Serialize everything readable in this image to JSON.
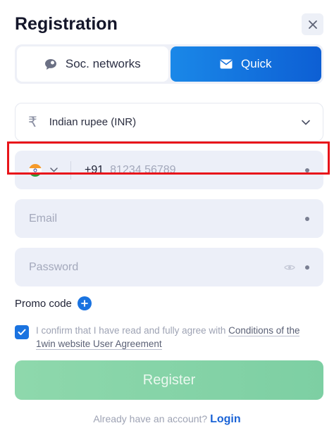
{
  "header": {
    "title": "Registration"
  },
  "tabs": [
    {
      "label": "Soc. networks",
      "icon": "chat-bubble-icon",
      "active": false
    },
    {
      "label": "Quick",
      "icon": "envelope-icon",
      "active": true
    }
  ],
  "form": {
    "currency": {
      "icon": "rupee-icon",
      "label": "Indian rupee (INR)"
    },
    "phone": {
      "country_flag": "india-flag-icon",
      "code": "+91",
      "placeholder": "81234 56789"
    },
    "email": {
      "placeholder": "Email"
    },
    "password": {
      "placeholder": "Password"
    },
    "promo_label": "Promo code",
    "agreement": {
      "checked": true,
      "text": "I confirm that I have read and fully agree with ",
      "link_text": "Conditions of the 1win website User Agreement"
    },
    "register_label": "Register"
  },
  "footer": {
    "prompt": "Already have an account?",
    "login_label": "Login"
  },
  "colors": {
    "accent_blue": "#0d5fd4",
    "register_green": "#8ed8ac",
    "highlight_red": "#e8141a"
  }
}
